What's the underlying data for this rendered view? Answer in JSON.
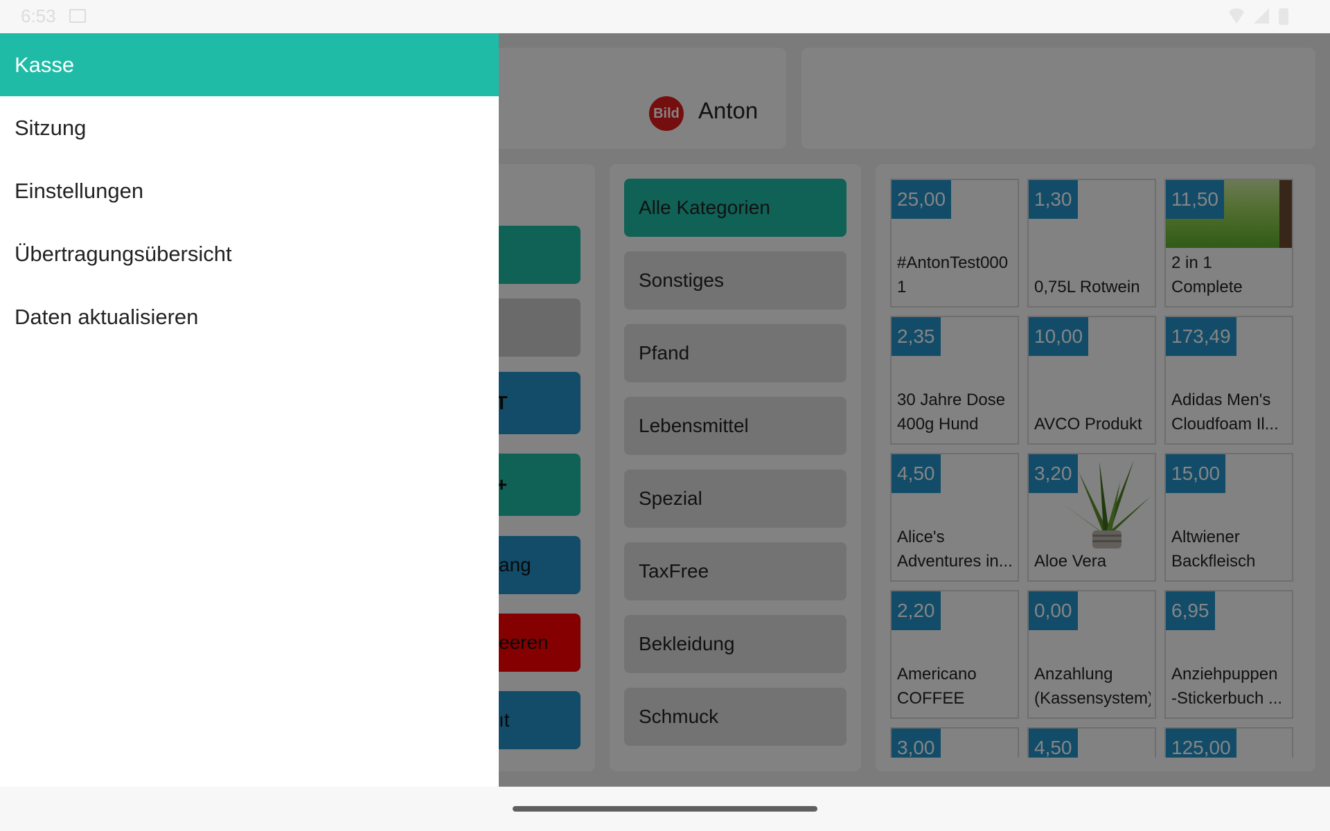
{
  "status_bar": {
    "time": "6:53",
    "icons": [
      "cast-icon",
      "wifi-icon",
      "signal-icon",
      "battery-icon"
    ]
  },
  "header": {
    "user_name": "Anton",
    "avatar_text": "Bild",
    "search": {
      "value": ""
    }
  },
  "actions": [
    {
      "label": "",
      "color": "teal"
    },
    {
      "label": "",
      "color": "grey"
    },
    {
      "label": "T",
      "color": "blue"
    },
    {
      "label": "+",
      "color": "teal"
    },
    {
      "label": "ang",
      "color": "blue"
    },
    {
      "label": "eeren",
      "color": "red"
    },
    {
      "label": "ıt",
      "color": "blue"
    }
  ],
  "categories": [
    {
      "label": "Alle Kategorien",
      "active": true
    },
    {
      "label": "Sonstiges"
    },
    {
      "label": "Pfand"
    },
    {
      "label": "Lebensmittel"
    },
    {
      "label": "Spezial"
    },
    {
      "label": "TaxFree"
    },
    {
      "label": "Bekleidung"
    },
    {
      "label": "Schmuck"
    }
  ],
  "products": [
    {
      "price": "25,00",
      "name": "#AntonTest0001"
    },
    {
      "price": "1,30",
      "name": "0,75L Rotwein"
    },
    {
      "price": "11,50",
      "name": "2 in 1 Complete",
      "image": "grass-photo"
    },
    {
      "price": "2,35",
      "name": "30 Jahre Dose 400g Hund"
    },
    {
      "price": "10,00",
      "name": "AVCO Produkt"
    },
    {
      "price": "173,49",
      "name": "Adidas Men's Cloudfoam Il..."
    },
    {
      "price": "4,50",
      "name": "Alice's Adventures in..."
    },
    {
      "price": "3,20",
      "name": "Aloe Vera",
      "image": "aloe-plant"
    },
    {
      "price": "15,00",
      "name": "Altwiener Backfleisch"
    },
    {
      "price": "2,20",
      "name": "Americano COFFEE"
    },
    {
      "price": "0,00",
      "name": "Anzahlung (Kassensystem)"
    },
    {
      "price": "6,95",
      "name": "Anziehpuppen -Stickerbuch ..."
    },
    {
      "price": "3,00",
      "name": ""
    },
    {
      "price": "4,50",
      "name": ""
    },
    {
      "price": "125,00",
      "name": ""
    }
  ],
  "drawer": {
    "items": [
      {
        "label": "Kasse",
        "active": true
      },
      {
        "label": "Sitzung"
      },
      {
        "label": "Einstellungen"
      },
      {
        "label": "Übertragungsübersicht"
      },
      {
        "label": "Daten aktualisieren"
      }
    ]
  },
  "colors": {
    "accent": "#1fbba6",
    "price_badge": "#2393c7",
    "danger": "#ff0000"
  }
}
